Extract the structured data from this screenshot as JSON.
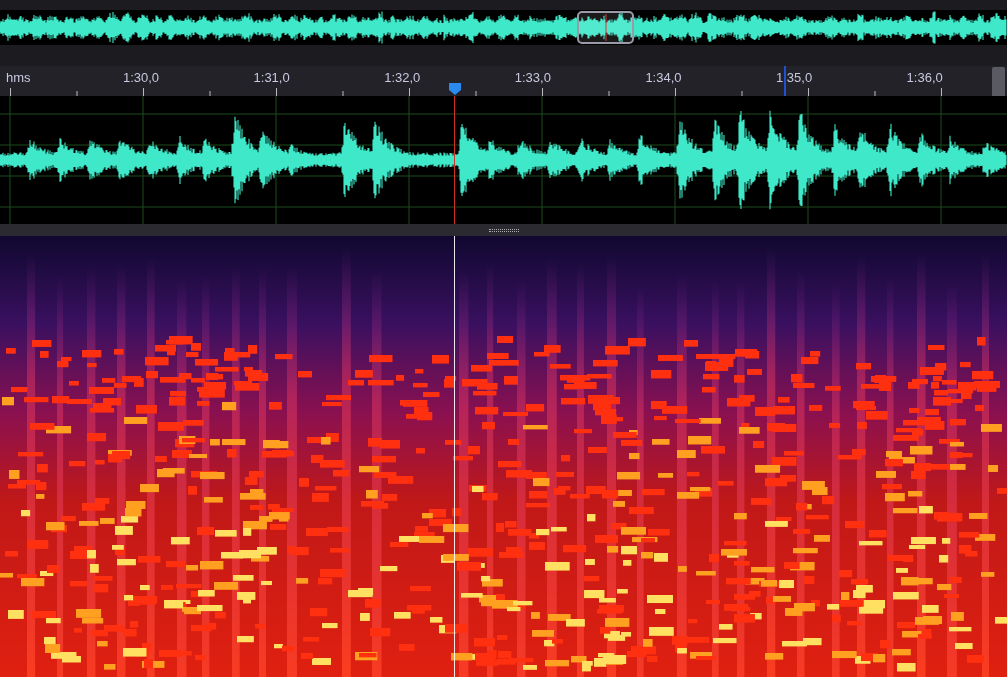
{
  "ruler": {
    "unit": "hms",
    "labels": [
      "1:30,0",
      "1:31,0",
      "1:32,0",
      "1:33,0",
      "1:34,0",
      "1:35,0",
      "1:36,0"
    ]
  }
}
